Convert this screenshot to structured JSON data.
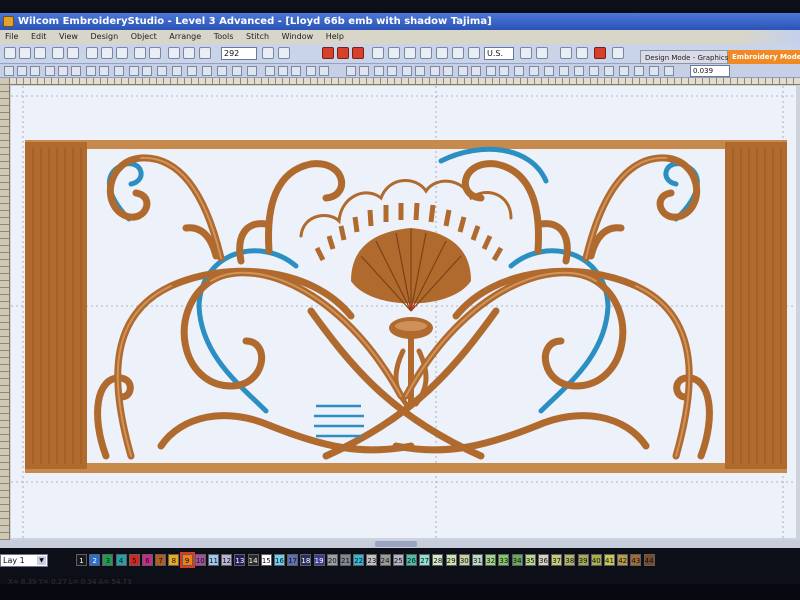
{
  "window": {
    "title": "Wilcom EmbroideryStudio - Level 3 Advanced - [Lloyd 66b emb with shadow      Tajima]"
  },
  "menubar": {
    "items": [
      "File",
      "Edit",
      "View",
      "Design",
      "Object",
      "Arrange",
      "Tools",
      "Stitch",
      "Window",
      "Help"
    ]
  },
  "toolbar": {
    "zoom_value": "292",
    "units_value": "U.S.",
    "field_value": "0.039"
  },
  "modes": {
    "design": "Design Mode - Graphics View",
    "embroidery": "Embroidery Mode"
  },
  "bottom": {
    "design_select": "Lay 1",
    "status_text": "X= 8.39 Y= 0.27 L= 0.34 A= 54.73"
  },
  "palette": [
    {
      "label": "1",
      "color": "#1a1a1a"
    },
    {
      "label": "2",
      "color": "#2a6fd1"
    },
    {
      "label": "3",
      "color": "#1f9a54"
    },
    {
      "label": "4",
      "color": "#25a0a6"
    },
    {
      "label": "5",
      "color": "#d1271f"
    },
    {
      "label": "6",
      "color": "#c62e86"
    },
    {
      "label": "7",
      "color": "#b35d22"
    },
    {
      "label": "8",
      "color": "#e9a81f"
    },
    {
      "label": "9",
      "color": "#f07f18"
    },
    {
      "label": "10",
      "color": "#a54fa1"
    },
    {
      "label": "11",
      "color": "#9ec7ef"
    },
    {
      "label": "12",
      "color": "#b9b4d6"
    },
    {
      "label": "13",
      "color": "#1e1e60"
    },
    {
      "label": "14",
      "color": "#2a2a2a"
    },
    {
      "label": "15",
      "color": "#ffffff"
    },
    {
      "label": "16",
      "color": "#6dd2f0"
    },
    {
      "label": "17",
      "color": "#5f6fb5"
    },
    {
      "label": "18",
      "color": "#26305e"
    },
    {
      "label": "19",
      "color": "#3c3c98"
    },
    {
      "label": "20",
      "color": "#9aa0a8"
    },
    {
      "label": "21",
      "color": "#7c8894"
    },
    {
      "label": "22",
      "color": "#36b6d9"
    },
    {
      "label": "23",
      "color": "#c1c1c1"
    },
    {
      "label": "24",
      "color": "#9b9b9b"
    },
    {
      "label": "25",
      "color": "#b0b7c3"
    },
    {
      "label": "26",
      "color": "#4ac0a8"
    },
    {
      "label": "27",
      "color": "#8fe0cf"
    },
    {
      "label": "28",
      "color": "#d3e8c9"
    },
    {
      "label": "29",
      "color": "#cfe3b3"
    },
    {
      "label": "30",
      "color": "#c8cf9e"
    },
    {
      "label": "31",
      "color": "#b9dcc9"
    },
    {
      "label": "32",
      "color": "#9fd48c"
    },
    {
      "label": "33",
      "color": "#82c46b"
    },
    {
      "label": "34",
      "color": "#6aa85e"
    },
    {
      "label": "35",
      "color": "#b8d68f"
    },
    {
      "label": "36",
      "color": "#d7d1c1"
    },
    {
      "label": "37",
      "color": "#c5cb7b"
    },
    {
      "label": "38",
      "color": "#b5b368"
    },
    {
      "label": "39",
      "color": "#a5a75c"
    },
    {
      "label": "40",
      "color": "#a8b04c"
    },
    {
      "label": "41",
      "color": "#c8c857"
    },
    {
      "label": "42",
      "color": "#b79a4c"
    },
    {
      "label": "43",
      "color": "#9f6b3c"
    },
    {
      "label": "44",
      "color": "#7a4a2a"
    }
  ],
  "colors": {
    "thread_gold": "#b06a2e",
    "thread_highlight": "#dca26a",
    "thread_blue": "#2b8fc2",
    "canvas": "#ecf1fa",
    "mode_active": "#f08a25"
  }
}
